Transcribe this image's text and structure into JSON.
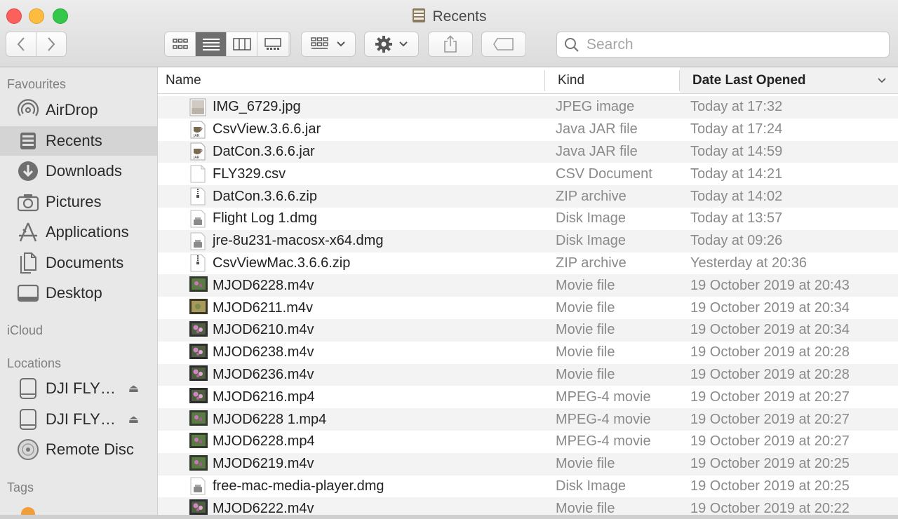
{
  "window": {
    "title": "Recents"
  },
  "toolbar": {
    "back_icon": "chevron-left-icon",
    "forward_icon": "chevron-right-icon",
    "view_modes": [
      "icon-view",
      "list-view",
      "column-view",
      "gallery-view"
    ],
    "active_view": "list-view",
    "search_placeholder": "Search"
  },
  "sidebar": {
    "favourites_label": "Favourites",
    "favourites": [
      {
        "label": "AirDrop",
        "icon": "airdrop-icon"
      },
      {
        "label": "Recents",
        "icon": "recents-icon",
        "selected": true
      },
      {
        "label": "Downloads",
        "icon": "downloads-icon"
      },
      {
        "label": "Pictures",
        "icon": "camera-icon"
      },
      {
        "label": "Applications",
        "icon": "applications-icon"
      },
      {
        "label": "Documents",
        "icon": "document-icon"
      },
      {
        "label": "Desktop",
        "icon": "desktop-icon"
      }
    ],
    "icloud_label": "iCloud",
    "locations_label": "Locations",
    "locations": [
      {
        "label": "DJI FLY…",
        "icon": "drive-icon",
        "eject": "⏏"
      },
      {
        "label": "DJI FLY…",
        "icon": "drive-icon",
        "eject": "⏏"
      },
      {
        "label": "Remote Disc",
        "icon": "disc-icon"
      }
    ],
    "tags_label": "Tags"
  },
  "columns": {
    "name": "Name",
    "kind": "Kind",
    "date": "Date Last Opened"
  },
  "files": [
    {
      "name": "IMG_6729.jpg",
      "kind": "JPEG image",
      "date": "Today at 17:32",
      "icon": "image"
    },
    {
      "name": "CsvView.3.6.6.jar",
      "kind": "Java JAR file",
      "date": "Today at 17:24",
      "icon": "jar"
    },
    {
      "name": "DatCon.3.6.6.jar",
      "kind": "Java JAR file",
      "date": "Today at 14:59",
      "icon": "jar"
    },
    {
      "name": "FLY329.csv",
      "kind": "CSV Document",
      "date": "Today at 14:21",
      "icon": "doc"
    },
    {
      "name": "DatCon.3.6.6.zip",
      "kind": "ZIP archive",
      "date": "Today at 14:02",
      "icon": "zip"
    },
    {
      "name": "Flight Log 1.dmg",
      "kind": "Disk Image",
      "date": "Today at 13:57",
      "icon": "dmg"
    },
    {
      "name": "jre-8u231-macosx-x64.dmg",
      "kind": "Disk Image",
      "date": "Today at 09:26",
      "icon": "dmg"
    },
    {
      "name": "CsvViewMac.3.6.6.zip",
      "kind": "ZIP archive",
      "date": "Yesterday at 20:36",
      "icon": "zip"
    },
    {
      "name": "MJOD6228.m4v",
      "kind": "Movie file",
      "date": "19 October 2019 at 20:43",
      "icon": "movie"
    },
    {
      "name": "MJOD6211.m4v",
      "kind": "Movie file",
      "date": "19 October 2019 at 20:34",
      "icon": "movie2"
    },
    {
      "name": "MJOD6210.m4v",
      "kind": "Movie file",
      "date": "19 October 2019 at 20:34",
      "icon": "movie3"
    },
    {
      "name": "MJOD6238.m4v",
      "kind": "Movie file",
      "date": "19 October 2019 at 20:28",
      "icon": "movie3"
    },
    {
      "name": "MJOD6236.m4v",
      "kind": "Movie file",
      "date": "19 October 2019 at 20:28",
      "icon": "movie3"
    },
    {
      "name": "MJOD6216.mp4",
      "kind": "MPEG-4 movie",
      "date": "19 October 2019 at 20:27",
      "icon": "movie3"
    },
    {
      "name": "MJOD6228 1.mp4",
      "kind": "MPEG-4 movie",
      "date": "19 October 2019 at 20:27",
      "icon": "movie"
    },
    {
      "name": "MJOD6228.mp4",
      "kind": "MPEG-4 movie",
      "date": "19 October 2019 at 20:27",
      "icon": "movie"
    },
    {
      "name": "MJOD6219.m4v",
      "kind": "Movie file",
      "date": "19 October 2019 at 20:25",
      "icon": "movie"
    },
    {
      "name": "free-mac-media-player.dmg",
      "kind": "Disk Image",
      "date": "19 October 2019 at 20:25",
      "icon": "dmg"
    },
    {
      "name": "MJOD6222.m4v",
      "kind": "Movie file",
      "date": "19 October 2019 at 20:22",
      "icon": "movie3"
    }
  ]
}
